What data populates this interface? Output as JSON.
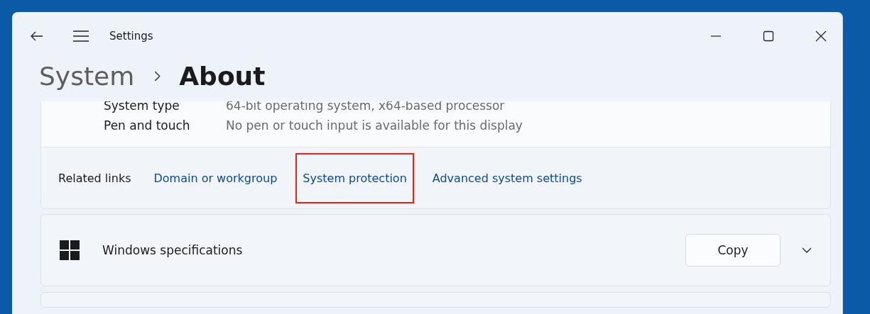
{
  "window": {
    "title": "Settings"
  },
  "breadcrumb": {
    "parent": "System",
    "current": "About"
  },
  "device_specs": [
    {
      "label": "System type",
      "value": "64-bit operating system, x64-based processor"
    },
    {
      "label": "Pen and touch",
      "value": "No pen or touch input is available for this display"
    }
  ],
  "related_links": {
    "label": "Related links",
    "links": [
      {
        "text": "Domain or workgroup",
        "highlighted": false
      },
      {
        "text": "System protection",
        "highlighted": true
      },
      {
        "text": "Advanced system settings",
        "highlighted": false
      }
    ]
  },
  "windows_specifications": {
    "title": "Windows specifications",
    "button": "Copy",
    "expanded": false
  }
}
